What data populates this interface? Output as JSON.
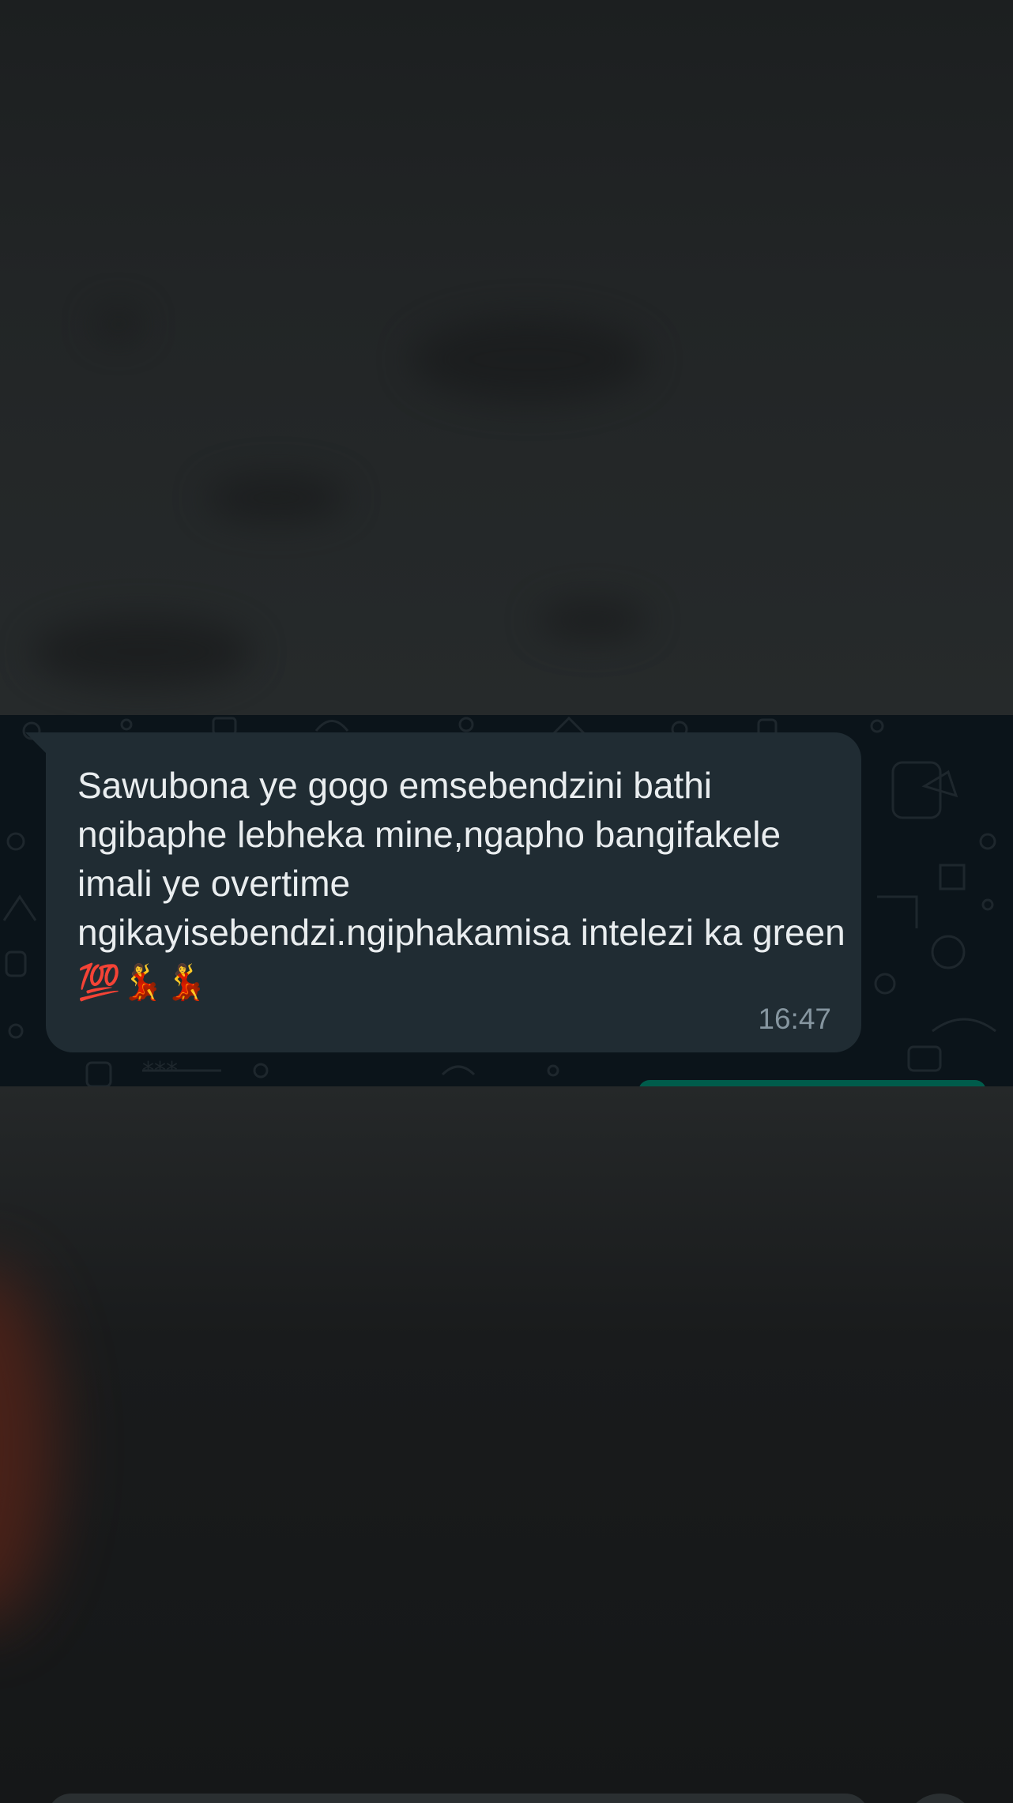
{
  "message": {
    "text": "Sawubona ye gogo emsebendzini bathi ngibaphe lebheka mine,ngapho bangifakele imali ye overtime ngikayisebendzi.ngiphakamisa intelezi ka green ",
    "emoji": "💯💃💃",
    "time": "16:47"
  },
  "colors": {
    "chat_background": "#0b141a",
    "incoming_bubble": "#202c33",
    "outgoing_bubble": "#005c4b",
    "message_text": "#e9edef",
    "timestamp_text": "#8696a0"
  }
}
